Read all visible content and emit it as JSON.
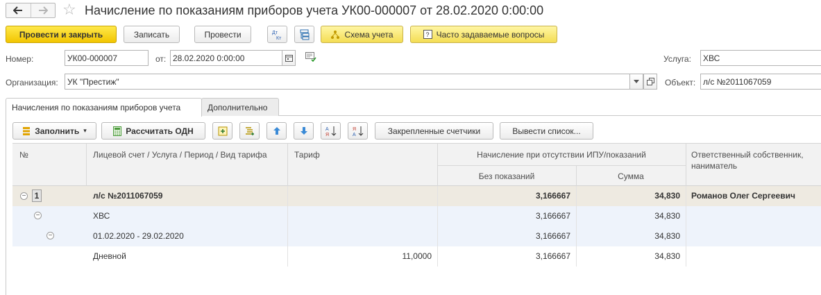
{
  "window": {
    "title": "Начисление по показаниям приборов учета УК00-000007 от 28.02.2020 0:00:00"
  },
  "toolbar": {
    "post_and_close": "Провести и закрыть",
    "save": "Записать",
    "post": "Провести",
    "scheme": "Схема учета",
    "faq": "Часто задаваемые вопросы",
    "dt_kt_top": "Дт",
    "dt_kt_bottom": "Кт"
  },
  "form": {
    "number_label": "Номер:",
    "number_value": "УК00-000007",
    "date_label": "от:",
    "date_value": "28.02.2020  0:00:00",
    "org_label": "Организация:",
    "org_value": "УК \"Престиж\"",
    "service_label": "Услуга:",
    "service_value": "ХВС",
    "object_label": "Объект:",
    "object_value": "л/с №2011067059"
  },
  "tabs": [
    {
      "label": "Начисления по показаниям приборов учета",
      "active": true
    },
    {
      "label": "Дополнительно",
      "active": false
    }
  ],
  "table_toolbar": {
    "fill": "Заполнить",
    "calc_odn": "Рассчитать ОДН",
    "pinned_meters": "Закрепленные счетчики",
    "export_list": "Вывести список..."
  },
  "table": {
    "headers": {
      "num": "№",
      "account": "Лицевой счет / Услуга / Период / Вид тарифа",
      "tariff": "Тариф",
      "accrual_group": "Начисление при отсутствии ИПУ/показаний",
      "no_readings": "Без показаний",
      "sum": "Сумма",
      "owner": "Ответственный собственник, наниматель"
    },
    "rows": [
      {
        "num": "1",
        "account": "л/с №2011067059",
        "tariff": "",
        "no_readings": "3,166667",
        "sum": "34,830",
        "owner": "Романов Олег Сергеевич"
      },
      {
        "num": "",
        "account": "ХВС",
        "tariff": "",
        "no_readings": "3,166667",
        "sum": "34,830",
        "owner": ""
      },
      {
        "num": "",
        "account": "01.02.2020 - 29.02.2020",
        "tariff": "",
        "no_readings": "3,166667",
        "sum": "34,830",
        "owner": ""
      },
      {
        "num": "",
        "account": "Дневной",
        "tariff": "11,0000",
        "no_readings": "3,166667",
        "sum": "34,830",
        "owner": ""
      }
    ]
  },
  "colors": {
    "primary_button": "#f2c500",
    "group_row": "#eeeae1",
    "sub_row": "#eef3fb",
    "header_bg": "#f2f2f2"
  }
}
